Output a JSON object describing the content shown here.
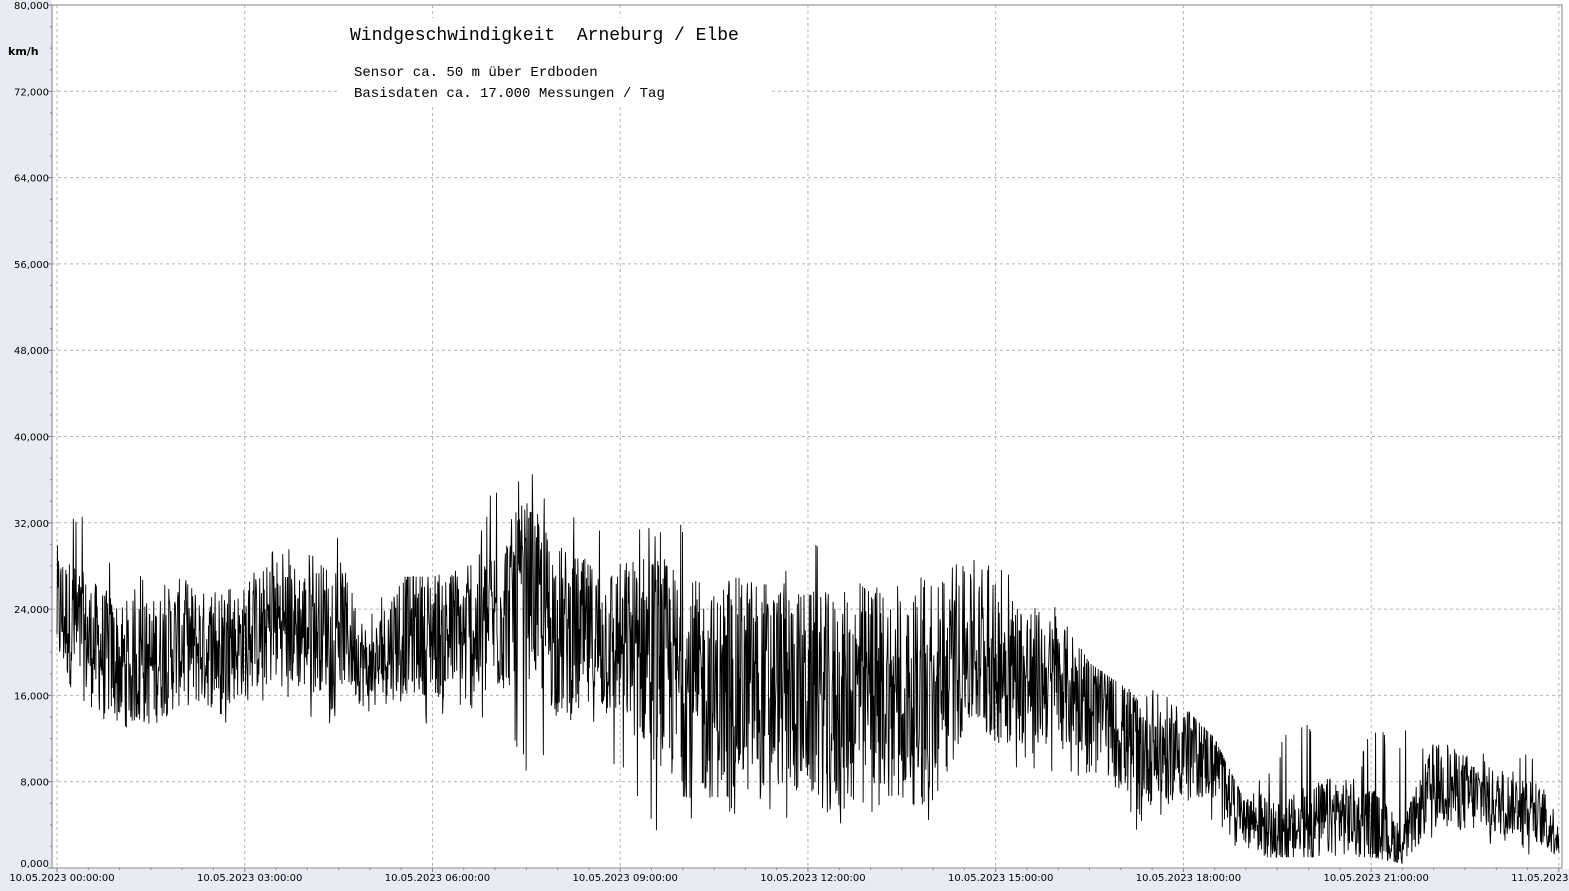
{
  "chart_data": {
    "type": "line",
    "title": "Windgeschwindigkeit  Arneburg / Elbe",
    "subtitle_lines": [
      "Sensor ca. 50 m über Erdboden",
      "Basisdaten ca. 17.000 Messungen / Tag"
    ],
    "ylabel": "km/h",
    "ylim": [
      0,
      80
    ],
    "y_ticks": [
      "0,000",
      "8,000",
      "16,000",
      "24,000",
      "32,000",
      "40,000",
      "48,000",
      "56,000",
      "64,000",
      "72,000",
      "80,000"
    ],
    "x_tick_labels": [
      "10.05.2023  00:00:00",
      "10.05.2023  03:00:00",
      "10.05.2023  06:00:00",
      "10.05.2023  09:00:00",
      "10.05.2023  12:00:00",
      "10.05.2023  15:00:00",
      "10.05.2023  18:00:00",
      "10.05.2023  21:00:00",
      "11.05.2023  00:00:00"
    ],
    "x_range_hours": [
      -0.08,
      24.05
    ],
    "grid": true,
    "line_color": "#000000",
    "series": [
      {
        "x_hours": [
          0,
          0.5,
          1,
          1.5,
          2,
          2.5,
          3,
          3.5,
          4,
          4.5,
          5,
          5.5,
          6,
          6.5,
          7,
          7.5,
          8,
          8.5,
          9,
          9.5,
          10,
          10.5,
          11,
          11.5,
          12,
          12.5,
          13,
          13.5,
          14,
          14.5,
          15,
          15.5,
          16,
          16.5,
          17,
          17.5,
          18,
          18.5,
          19,
          19.5,
          20,
          20.5,
          21,
          21.5,
          22,
          22.5,
          23,
          23.5,
          24
        ],
        "mean": [
          24,
          21,
          19,
          19,
          21,
          20,
          21,
          23,
          22,
          23,
          18,
          22,
          22,
          21,
          23,
          26,
          22,
          21,
          21,
          20,
          17,
          16,
          17,
          17,
          16,
          15,
          17,
          16,
          14,
          20,
          19,
          18,
          17,
          16,
          12,
          11,
          11,
          10,
          5,
          3,
          4,
          5,
          4,
          2,
          8,
          7,
          6,
          6,
          3
        ],
        "spread": [
          8,
          8,
          8,
          8,
          8,
          7,
          7,
          8,
          8,
          8,
          5,
          8,
          8,
          9,
          10,
          11,
          11,
          10,
          10,
          13,
          14,
          13,
          14,
          13,
          13,
          14,
          13,
          13,
          12,
          10,
          10,
          9,
          8,
          7,
          7,
          7,
          6,
          5,
          4,
          4,
          5,
          5,
          5,
          3,
          5,
          5,
          4,
          4,
          3
        ],
        "max": [
          34,
          33,
          28,
          27,
          27,
          26,
          26,
          31,
          30,
          31,
          24,
          27,
          27,
          28,
          36,
          37,
          35,
          33,
          33,
          32,
          32,
          27,
          29,
          28,
          31,
          29,
          26,
          27,
          27,
          29,
          29,
          27,
          24,
          19,
          17,
          17,
          15,
          12,
          6,
          12,
          14,
          7,
          13,
          13,
          13,
          12,
          10,
          11,
          7
        ],
        "min": [
          17,
          13,
          13,
          12,
          11,
          12,
          14,
          14,
          14,
          13,
          10,
          14,
          12,
          13,
          14,
          9,
          9,
          8,
          8,
          3,
          3,
          5,
          5,
          4,
          4,
          4,
          5,
          5,
          4,
          9,
          10,
          9,
          8,
          8,
          4,
          3,
          6,
          4,
          1,
          1,
          1,
          1,
          1,
          0.4,
          2,
          2,
          2,
          1,
          1
        ]
      }
    ]
  },
  "colors": {
    "background": "#ffffff",
    "left_margin_band": "#e8ebf2",
    "grid": "#b4b4b4",
    "axis": "#808080",
    "line": "#000000"
  }
}
